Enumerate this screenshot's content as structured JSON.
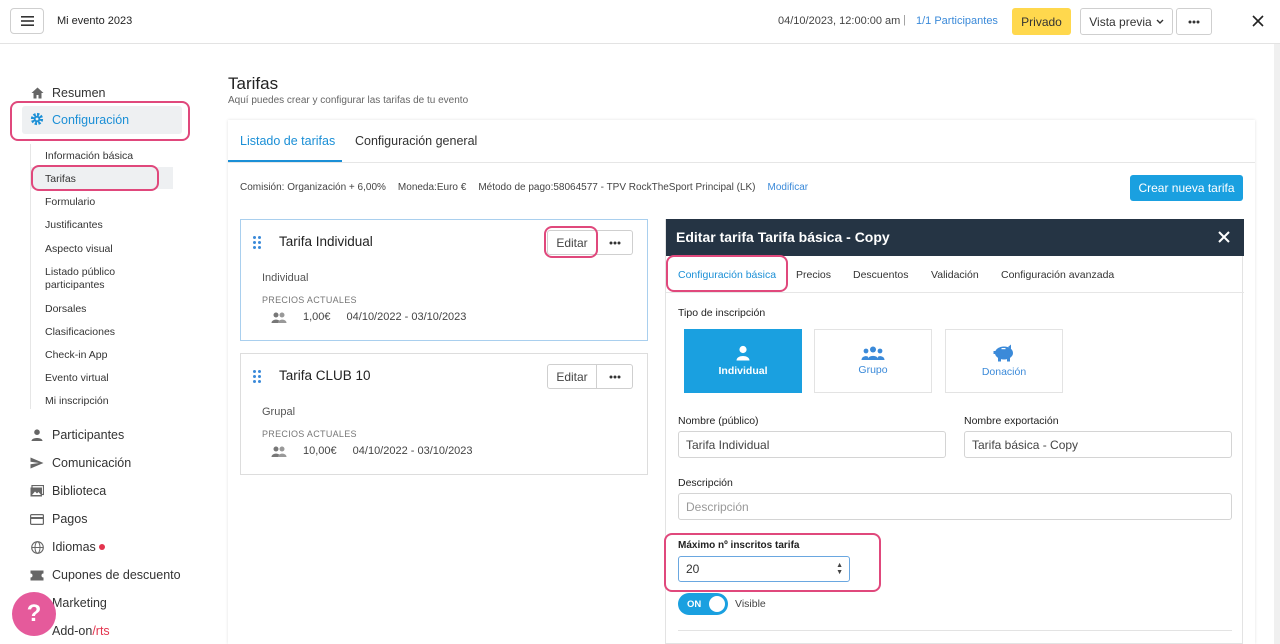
{
  "topbar": {
    "event_name": "Mi evento 2023",
    "date": "04/10/2023, 12:00:00 am",
    "separator": "|",
    "participants": "1/1 Participantes",
    "privado": "Privado",
    "preview": "Vista previa"
  },
  "sidebar": {
    "resumen": "Resumen",
    "configuracion": "Configuración",
    "sub_items": [
      "Información básica",
      "Tarifas",
      "Formulario",
      "Justificantes",
      "Aspecto visual",
      "Listado público participantes",
      "Dorsales",
      "Clasificaciones",
      "Check-in App",
      "Evento virtual",
      "Mi inscripción"
    ],
    "participantes": "Participantes",
    "comunicacion": "Comunicación",
    "biblioteca": "Biblioteca",
    "pagos": "Pagos",
    "idiomas": "Idiomas",
    "cupones": "Cupones de descuento",
    "marketing": "Marketing",
    "addon_main": "Add-on",
    "addon_accent": "/rts",
    "help": "?"
  },
  "page": {
    "title": "Tarifas",
    "subtitle": "Aquí puedes crear y configurar las tarifas de tu evento",
    "tabs": [
      "Listado de tarifas",
      "Configuración general"
    ],
    "commission": "Comisión: Organización + 6,00%",
    "currency": "Moneda:Euro €",
    "payment": "Método de pago:58064577 - TPV RockTheSport Principal (LK)",
    "modify": "Modificar",
    "create_btn": "Crear nueva tarifa"
  },
  "tarifas": [
    {
      "name": "Tarifa Individual",
      "type": "Individual",
      "prices_label": "PRECIOS ACTUALES",
      "price": "1,00€",
      "range": "04/10/2022 - 03/10/2023",
      "edit": "Editar"
    },
    {
      "name": "Tarifa CLUB 10",
      "type": "Grupal",
      "prices_label": "PRECIOS ACTUALES",
      "price": "10,00€",
      "range": "04/10/2022 - 03/10/2023",
      "edit": "Editar"
    }
  ],
  "modal": {
    "title": "Editar tarifa Tarifa básica - Copy",
    "tabs": [
      "Configuración básica",
      "Precios",
      "Descuentos",
      "Validación",
      "Configuración avanzada"
    ],
    "tipo_label": "Tipo de inscripción",
    "types": [
      "Individual",
      "Grupo",
      "Donación"
    ],
    "nombre_label": "Nombre (público)",
    "nombre_value": "Tarifa Individual",
    "export_label": "Nombre exportación",
    "export_value": "Tarifa básica - Copy",
    "desc_label": "Descripción",
    "desc_placeholder": "Descripción",
    "max_label": "Máximo nº inscritos tarifa",
    "max_value": "20",
    "toggle": "ON",
    "visible": "Visible"
  },
  "colors": {
    "accent": "#1aa0e0",
    "highlight": "#e0487c",
    "privado": "#ffd84d",
    "modal_header": "#253444"
  }
}
